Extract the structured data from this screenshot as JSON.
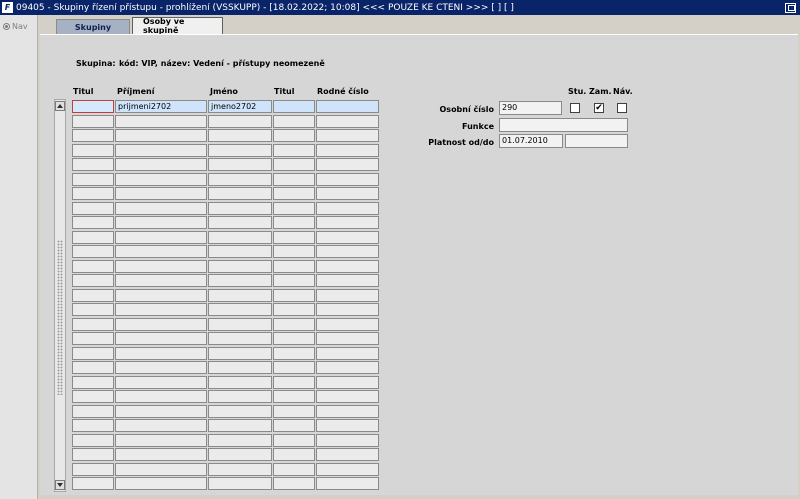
{
  "window": {
    "app_icon": "F",
    "title": "09405 - Skupiny řízení přístupu - prohlížení (VSSKUPP) - [18.02.2022; 10:08] <<< POUZE KE ČTENÍ >>>  [ ]  [ ]",
    "restore_icon": "restore-icon"
  },
  "nav": {
    "label": "Nav",
    "icon": "nav-icon"
  },
  "tabs": [
    {
      "label": "Skupiny",
      "active": false
    },
    {
      "label": "Osoby ve skupině",
      "active": true
    }
  ],
  "group": {
    "label": "Skupina:",
    "value": "kód: VIP, název: Vedení - přístupy neomezeně"
  },
  "table": {
    "columns": [
      "Titul",
      "Příjmení",
      "Jméno",
      "Titul",
      "Rodné číslo"
    ],
    "rows": [
      [
        "",
        "prijmeni2702",
        "jmeno2702",
        "",
        ""
      ],
      [
        "",
        "",
        "",
        "",
        ""
      ],
      [
        "",
        "",
        "",
        "",
        ""
      ],
      [
        "",
        "",
        "",
        "",
        ""
      ],
      [
        "",
        "",
        "",
        "",
        ""
      ],
      [
        "",
        "",
        "",
        "",
        ""
      ],
      [
        "",
        "",
        "",
        "",
        ""
      ],
      [
        "",
        "",
        "",
        "",
        ""
      ],
      [
        "",
        "",
        "",
        "",
        ""
      ],
      [
        "",
        "",
        "",
        "",
        ""
      ],
      [
        "",
        "",
        "",
        "",
        ""
      ],
      [
        "",
        "",
        "",
        "",
        ""
      ],
      [
        "",
        "",
        "",
        "",
        ""
      ],
      [
        "",
        "",
        "",
        "",
        ""
      ],
      [
        "",
        "",
        "",
        "",
        ""
      ],
      [
        "",
        "",
        "",
        "",
        ""
      ],
      [
        "",
        "",
        "",
        "",
        ""
      ],
      [
        "",
        "",
        "",
        "",
        ""
      ],
      [
        "",
        "",
        "",
        "",
        ""
      ],
      [
        "",
        "",
        "",
        "",
        ""
      ],
      [
        "",
        "",
        "",
        "",
        ""
      ],
      [
        "",
        "",
        "",
        "",
        ""
      ],
      [
        "",
        "",
        "",
        "",
        ""
      ],
      [
        "",
        "",
        "",
        "",
        ""
      ],
      [
        "",
        "",
        "",
        "",
        ""
      ],
      [
        "",
        "",
        "",
        "",
        ""
      ],
      [
        "",
        "",
        "",
        "",
        ""
      ]
    ]
  },
  "detail": {
    "checkbox_headers": [
      "Stu.",
      "Zam.",
      "Náv."
    ],
    "checkboxes": [
      false,
      true,
      false
    ],
    "osobni_cislo_label": "Osobní číslo",
    "osobni_cislo_value": "290",
    "funkce_label": "Funkce",
    "funkce_value": "",
    "platnost_label": "Platnost od/do",
    "platnost_od": "01.07.2010",
    "platnost_do": ""
  },
  "colors": {
    "titlebar": "#0a246a",
    "current_row": "#cfe3fa",
    "tab_inactive": "#a6b1c4"
  }
}
